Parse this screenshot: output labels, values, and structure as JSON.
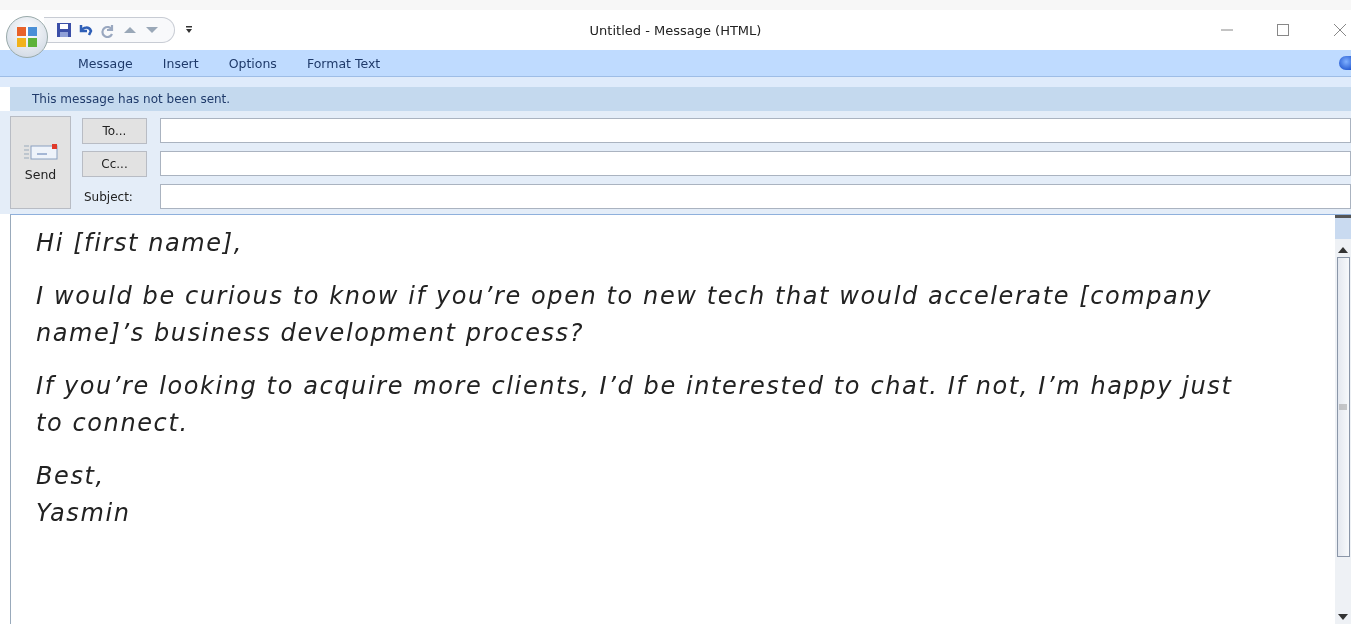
{
  "window": {
    "title": "Untitled - Message (HTML)"
  },
  "ribbon_tabs": [
    {
      "label": "Message"
    },
    {
      "label": "Insert"
    },
    {
      "label": "Options"
    },
    {
      "label": "Format Text"
    }
  ],
  "info_bar": "This message has not been sent.",
  "header": {
    "send_button": "Send",
    "to_button": "To...",
    "cc_button": "Cc...",
    "subject_label": "Subject:"
  },
  "body": [
    {
      "lines": [
        "Hi [first name],"
      ]
    },
    {
      "lines": [
        "I would be curious to know if you’re open to new tech that would accelerate [company name]’s business development process?"
      ]
    },
    {
      "lines": [
        "If you’re looking to acquire more clients, I’d be interested to chat. If not, I’m happy just to connect."
      ]
    },
    {
      "lines": [
        "Best,",
        "Yasmin"
      ]
    }
  ]
}
